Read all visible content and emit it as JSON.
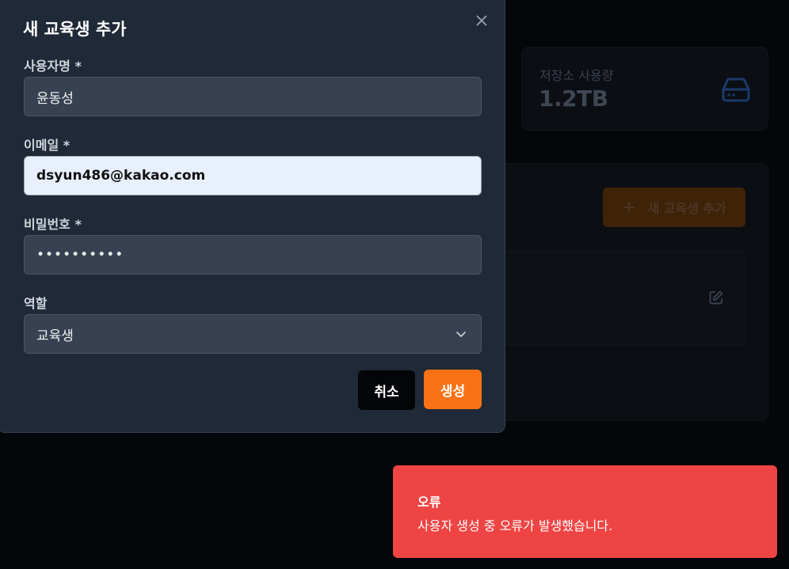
{
  "background": {
    "storage_card": {
      "label": "저장소 사용량",
      "value": "1.2TB",
      "icon": "hard-drive-icon"
    },
    "add_button_label": "새 교육생 추가",
    "row_icon": "edit-icon"
  },
  "modal": {
    "title": "새 교육생 추가",
    "close_icon": "close-icon",
    "fields": {
      "username": {
        "label": "사용자명 *",
        "value": "윤동성"
      },
      "email": {
        "label": "이메일 *",
        "value": "dsyun486@kakao.com"
      },
      "password": {
        "label": "비밀번호 *",
        "value": "••••••••••"
      },
      "role": {
        "label": "역할",
        "value": "교육생"
      }
    },
    "cancel_label": "취소",
    "create_label": "생성"
  },
  "toast": {
    "title": "오류",
    "message": "사용자 생성 중 오류가 발생했습니다."
  },
  "colors": {
    "accent": "#f97316",
    "error": "#ef4444",
    "modal_bg": "#1f2937",
    "field_bg": "#374151"
  }
}
